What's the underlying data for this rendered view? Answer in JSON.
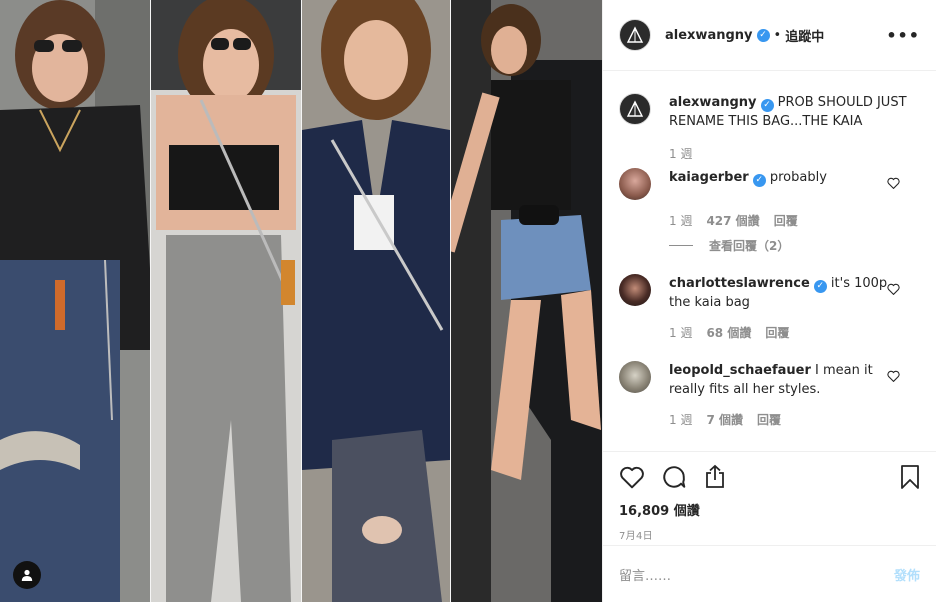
{
  "post": {
    "username": "alexwangny",
    "separator": "•",
    "follow_label": "追蹤中",
    "more_label": "•••",
    "verified_mark": "✓",
    "photo_alt_panels": 4
  },
  "caption": {
    "username": "alexwangny",
    "text": "PROB SHOULD JUST RENAME THIS BAG...THE KAIA",
    "time": "1 週"
  },
  "comments": [
    {
      "username": "kaiagerber",
      "verified": true,
      "text": "probably",
      "time": "1 週",
      "likes": "427 個讚",
      "reply": "回覆",
      "view_replies": "查看回覆（2）"
    },
    {
      "username": "charlottesLawrence",
      "username_display": "charlotteslawrence",
      "verified": true,
      "text": "it's 100p the kaia bag",
      "time": "1 週",
      "likes": "68 個讚",
      "reply": "回覆"
    },
    {
      "username": "leopold_schaefauer",
      "verified": false,
      "text": "I mean it really fits all her styles.",
      "time": "1 週",
      "likes": "7 個讚",
      "reply": "回覆"
    }
  ],
  "actions": {
    "like_count": "16,809 個讚",
    "date": "7月4日"
  },
  "add_comment": {
    "placeholder": "留言……",
    "post_label": "發佈"
  },
  "colors": {
    "accent": "#3897f0",
    "post_disabled": "#b2dffc",
    "muted": "#8e8e8e"
  },
  "icons": [
    "heart-icon",
    "comment-icon",
    "share-icon",
    "bookmark-icon",
    "user-tag-icon",
    "verified-icon",
    "more-icon"
  ]
}
